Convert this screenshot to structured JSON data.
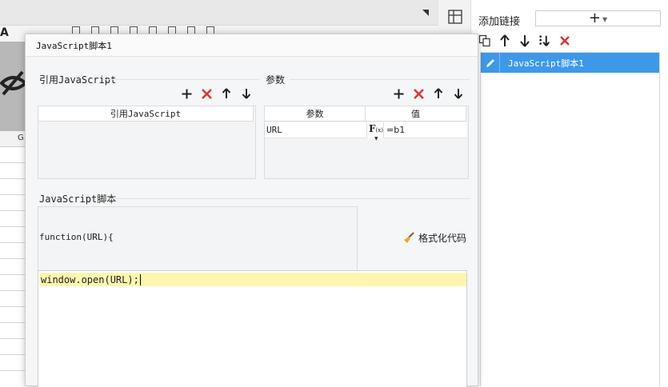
{
  "dialog": {
    "title": "JavaScript脚本1",
    "ref_js": {
      "section_title": "引用JavaScript",
      "column_header": "引用JavaScript"
    },
    "params": {
      "section_title": "参数",
      "column_param": "参数",
      "column_value": "值",
      "rows": [
        {
          "name": "URL",
          "value": "=b1"
        }
      ]
    },
    "script": {
      "section_title": "JavaScript脚本",
      "function_header": "function(URL){",
      "format_label": "格式化代码",
      "code_line": "window.open(URL);"
    }
  },
  "right_panel": {
    "add_link_label": "添加链接",
    "add_button": "+",
    "list_items": [
      {
        "label": "JavaScript脚本1",
        "selected": true
      }
    ]
  },
  "background": {
    "column_letter": "G",
    "font_glyph": "A"
  },
  "colors": {
    "accent_blue": "#3d99e8",
    "delete_red": "#e03030",
    "editor_highlight": "#fdf6b0"
  },
  "icons": [
    "plus-icon",
    "delete-icon",
    "arrow-up-icon",
    "arrow-down-icon",
    "copy-icon",
    "move-bottom-icon",
    "pencil-icon",
    "broom-icon",
    "fx-icon",
    "grid-icon",
    "eye-hidden-icon"
  ]
}
